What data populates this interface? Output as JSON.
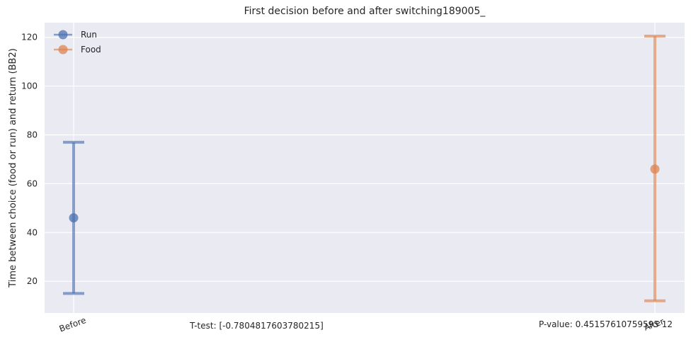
{
  "chart_data": {
    "type": "errorbar",
    "title": "First decision before and after switching189005_",
    "xlabel": "",
    "ylabel": "Time between choice (food or run) and return (BB2)",
    "categories": [
      "Before",
      "After"
    ],
    "ylim": [
      7,
      126
    ],
    "yticks": [
      20,
      40,
      60,
      80,
      100,
      120
    ],
    "grid": true,
    "legend_position": "top-left",
    "series": [
      {
        "name": "Run",
        "category": "Before",
        "mean": 46,
        "lower": 15,
        "upper": 77,
        "color": "#4c72b0"
      },
      {
        "name": "Food",
        "category": "After",
        "mean": 66,
        "lower": 12,
        "upper": 120.5,
        "color": "#dd8452"
      }
    ],
    "annotations": {
      "ttest": "T-test: [-0.7804817603780215]",
      "pvalue": "P-value: 0.45157610759595 12"
    }
  }
}
